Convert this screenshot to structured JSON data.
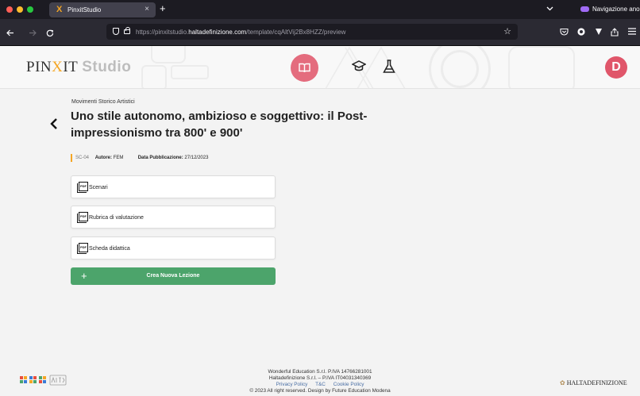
{
  "browser": {
    "tab_title": "PinxitStudio",
    "tab_favicon": "X",
    "tab_close": "×",
    "new_tab": "+",
    "tab_list_icon": "chevron-down-icon",
    "private_label": "Navigazione anonima",
    "url_prefix": "https://pinxitstudio.",
    "url_domain": "haltadefinizione.com",
    "url_path": "/template/cqAltVij2Bx8HZZ/preview"
  },
  "app": {
    "logo_part1": "PIN",
    "logo_x": "X",
    "logo_part2": "IT",
    "logo_studio": "Studio",
    "avatar_letter": "D",
    "nav_icons": [
      "book-icon",
      "graduation-cap-icon",
      "flask-icon"
    ],
    "accent_color": "#e46c7e"
  },
  "template": {
    "category": "Movimenti Storico Artistici",
    "title": "Uno stile autonomo, ambizioso e soggettivo: il Post-impressionismo tra 800' e 900'",
    "code": "SC-04",
    "author_label": "Autore:",
    "author": "FEM",
    "date_label": "Data Pubblicazione:",
    "date": "27/12/2023",
    "pdf_badge": "PDF",
    "documents": [
      {
        "label": "Scenari"
      },
      {
        "label": "Rubrica di valutazione"
      },
      {
        "label": "Scheda didattica"
      }
    ],
    "create_plus": "+",
    "create_label": "Crea Nuova Lezione",
    "create_color": "#4ca46b"
  },
  "footer": {
    "line1": "Wonderful Education S.r.l. P.IVA 14766281001",
    "line2": "Haltadefinizione S.r.l. – P.IVA IT04031340369",
    "links": [
      "Privacy Policy",
      "T&C",
      "Cookie Policy"
    ],
    "line4": "© 2023 All right reserved. Design by Future Education Modena",
    "partner_logo": "HALTADEFINIZIONE"
  }
}
